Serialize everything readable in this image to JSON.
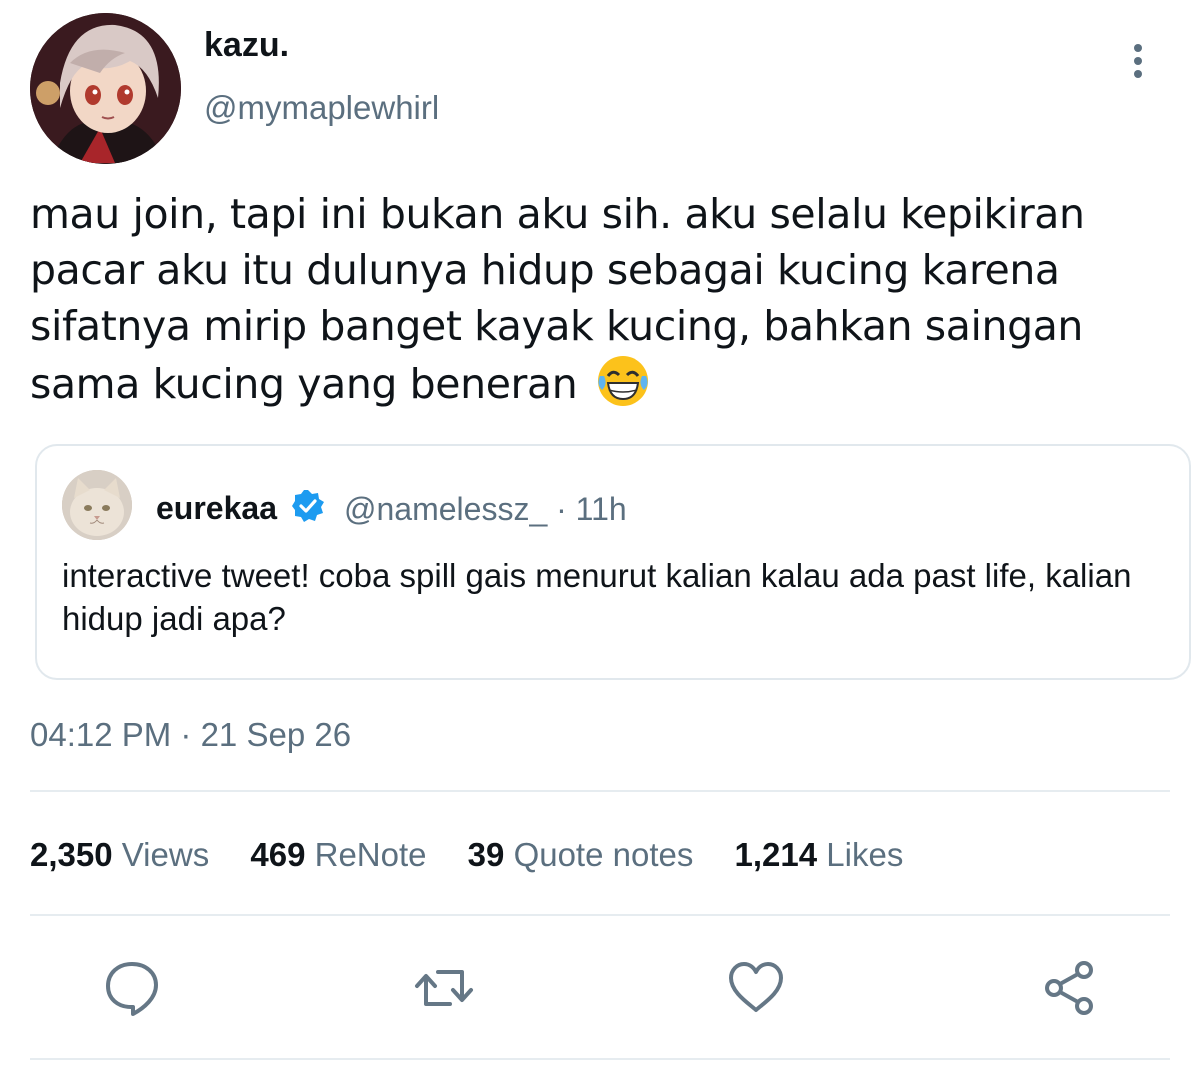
{
  "author": {
    "display_name": "kazu.",
    "handle": "@mymaplewhirl",
    "avatar_icon": "anime-character-avatar"
  },
  "tweet": {
    "text": "mau join, tapi ini bukan aku sih. aku selalu kepikiran pacar aku itu dulunya hidup sebagai kucing karena sifatnya mirip banget kayak kucing, bahkan saingan sama kucing yang beneran",
    "emoji_icon": "face-with-tears-of-joy-emoji"
  },
  "quoted": {
    "display_name": "eurekaa",
    "handle_time": "@namelessz_ · 11h",
    "text": "interactive tweet! coba spill gais menurut kalian kalau ada past life, kalian hidup jadi apa?",
    "avatar_icon": "cat-avatar",
    "verified_icon": "verified-badge-icon"
  },
  "timestamp": "04:12 PM · 21 Sep 26",
  "stats": [
    {
      "count": "2,350",
      "label": "Views"
    },
    {
      "count": "469",
      "label": "ReNote"
    },
    {
      "count": "39",
      "label": "Quote notes"
    },
    {
      "count": "1,214",
      "label": "Likes"
    }
  ],
  "actions": [
    "reply-icon",
    "renote-icon",
    "like-icon",
    "share-icon"
  ],
  "colors": {
    "text": "#0f1419",
    "secondary": "#5b6f7f",
    "border": "#e1e8ed",
    "verified": "#1d9bf0",
    "icons": "#657786"
  }
}
